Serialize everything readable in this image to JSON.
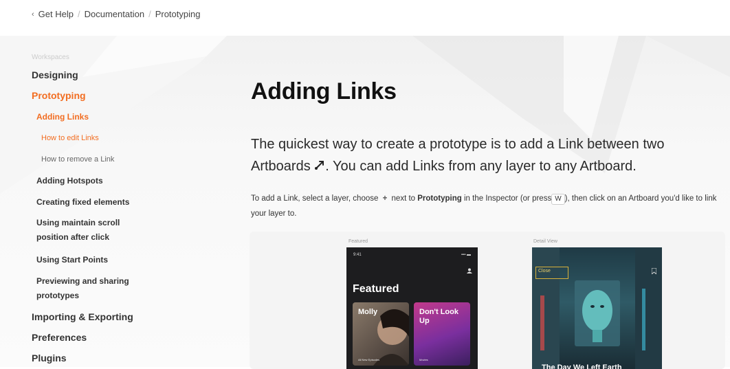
{
  "breadcrumb": {
    "back_icon": "chevron-left-icon",
    "items": [
      "Get Help",
      "Documentation",
      "Prototyping"
    ]
  },
  "sidebar": {
    "faded_item": "Workspaces",
    "items": [
      {
        "label": "Designing",
        "level": 1,
        "active": false
      },
      {
        "label": "Prototyping",
        "level": 1,
        "active": true
      },
      {
        "label": "Adding Links",
        "level": 2,
        "active": true
      },
      {
        "label": "How to edit Links",
        "level": 3,
        "active": true
      },
      {
        "label": "How to remove a Link",
        "level": 3,
        "active": false
      },
      {
        "label": "Adding Hotspots",
        "level": 2,
        "active": false
      },
      {
        "label": "Creating fixed elements",
        "level": 2,
        "active": false
      },
      {
        "label": "Using maintain scroll position after click",
        "level": 2,
        "active": false
      },
      {
        "label": "Using Start Points",
        "level": 2,
        "active": false
      },
      {
        "label": "Previewing and sharing prototypes",
        "level": 2,
        "active": false
      },
      {
        "label": "Importing & Exporting",
        "level": 1,
        "active": false
      },
      {
        "label": "Preferences",
        "level": 1,
        "active": false
      },
      {
        "label": "Plugins",
        "level": 1,
        "active": false
      }
    ]
  },
  "main": {
    "title": "Adding Links",
    "lead_part1": "The quickest way to create a prototype is to add a Link between two Artboards",
    "lead_part2": ". You can add Links from any layer to any Artboard.",
    "link_icon": "link-arrow-icon",
    "body_part1": "To add a Link, select a layer, choose",
    "body_plus": "+",
    "body_part2": "next to",
    "body_bold": "Prototyping",
    "body_part3": "in the Inspector (or press",
    "body_key": "W",
    "body_part4": "), then click on an Artboard you'd like to link your layer to."
  },
  "illustration": {
    "artboard1": {
      "label": "Featured",
      "status_time": "9:41",
      "heading": "Featured",
      "card1_title": "Molly",
      "card1_sub": "All New Episodes",
      "card2_title": "Don't Look Up",
      "card2_sub": "Movies"
    },
    "artboard2": {
      "label": "Detail View",
      "badge": "Close",
      "title": "The Day We Left Earth"
    }
  },
  "colors": {
    "accent": "#f26d21",
    "text": "#1c1c1e",
    "background": "#ffffff",
    "panel": "#f4f4f4",
    "phone": "#1d1d1f"
  }
}
